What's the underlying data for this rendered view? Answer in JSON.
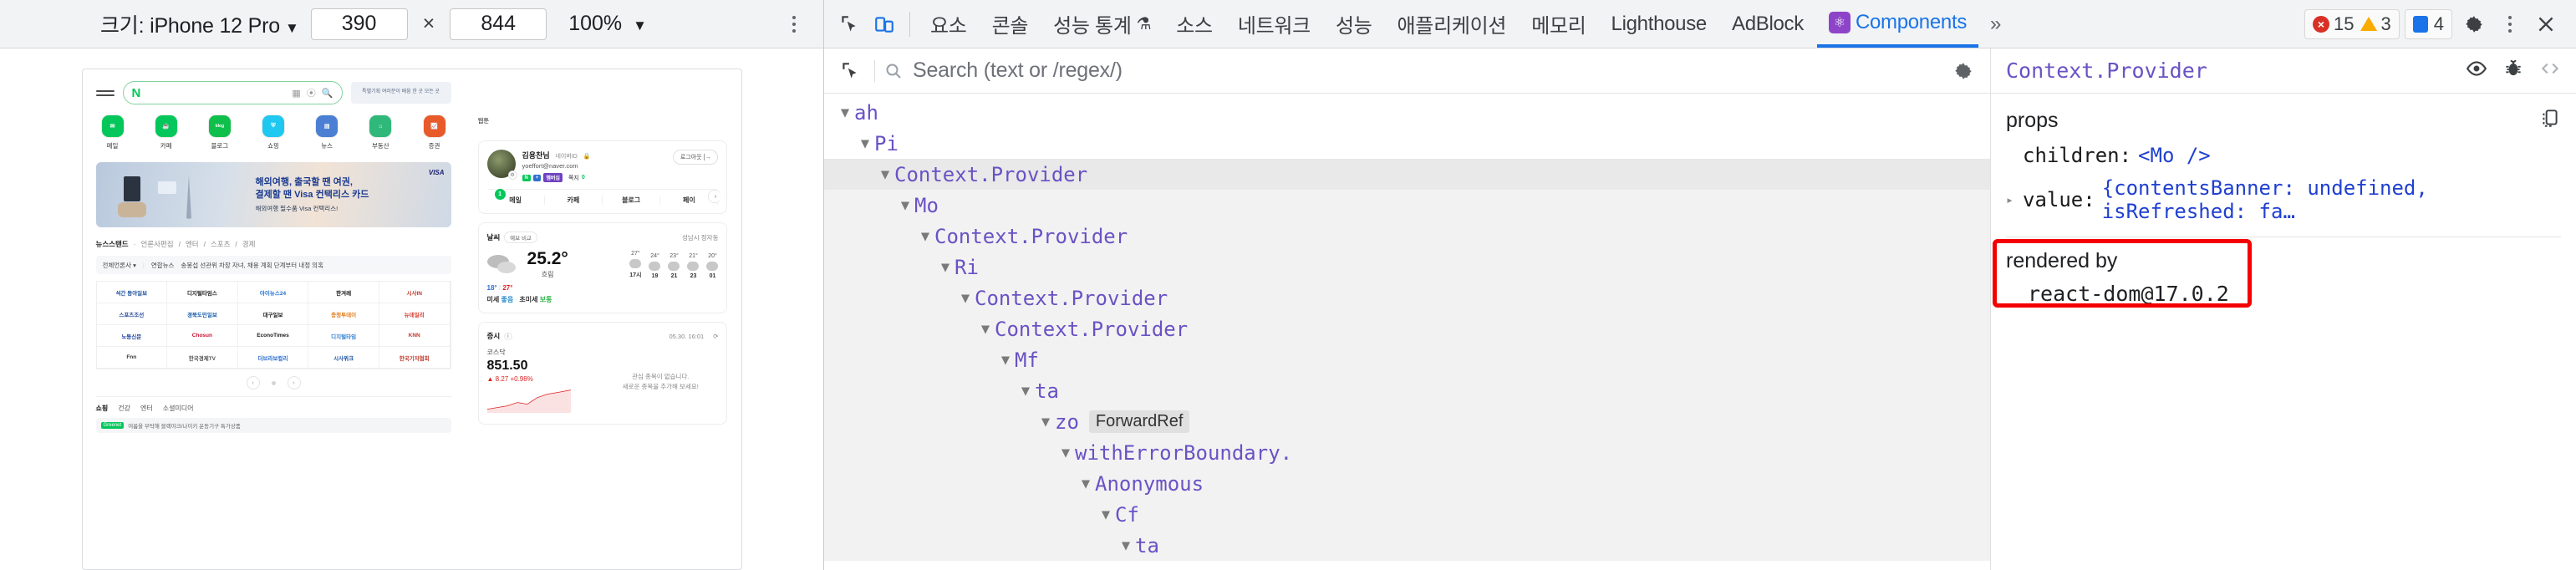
{
  "device_toolbar": {
    "size_label": "크기: iPhone 12 Pro",
    "caret": "▼",
    "width_value": "390",
    "times": "×",
    "height_value": "844",
    "zoom_value": "100%",
    "zoom_caret": "▼",
    "more_icon": "kebab-menu-icon"
  },
  "devtools_tabs": {
    "inspect_icon": "inspect-element-icon",
    "device_icon": "toggle-device-toolbar-icon",
    "items": [
      {
        "label": "요소",
        "active": false
      },
      {
        "label": "콘솔",
        "active": false
      },
      {
        "label": "성능 통계",
        "active": false,
        "icon": "flask-icon"
      },
      {
        "label": "소스",
        "active": false
      },
      {
        "label": "네트워크",
        "active": false
      },
      {
        "label": "성능",
        "active": false
      },
      {
        "label": "애플리케이션",
        "active": false
      },
      {
        "label": "메모리",
        "active": false
      },
      {
        "label": "Lighthouse",
        "active": false
      },
      {
        "label": "AdBlock",
        "active": false
      },
      {
        "label": "Components",
        "active": true,
        "icon": "react-atom-icon"
      }
    ],
    "overflow": "»",
    "error_count": "15",
    "warning_count": "3",
    "message_count": "4",
    "settings_icon": "gear-icon",
    "more_icon": "kebab-menu-icon",
    "close_icon": "close-icon"
  },
  "react_devtools": {
    "select_element_icon": "select-element-icon",
    "search_icon": "search-icon",
    "search_placeholder": "Search (text or /regex/)",
    "search_value": "",
    "settings_icon": "gear-icon",
    "tree": [
      {
        "label": "ah",
        "depth": 0,
        "arrow": "▼",
        "state": "normal"
      },
      {
        "label": "Pi",
        "depth": 1,
        "arrow": "▼",
        "state": "normal"
      },
      {
        "label": "Context.Provider",
        "depth": 2,
        "arrow": "▼",
        "state": "selected"
      },
      {
        "label": "Mo",
        "depth": 3,
        "arrow": "▼",
        "state": "tint"
      },
      {
        "label": "Context.Provider",
        "depth": 4,
        "arrow": "▼",
        "state": "tint"
      },
      {
        "label": "Ri",
        "depth": 5,
        "arrow": "▼",
        "state": "tint"
      },
      {
        "label": "Context.Provider",
        "depth": 6,
        "arrow": "▼",
        "state": "tint"
      },
      {
        "label": "Context.Provider",
        "depth": 7,
        "arrow": "▼",
        "state": "tint"
      },
      {
        "label": "Mf",
        "depth": 8,
        "arrow": "▼",
        "state": "tint"
      },
      {
        "label": "ta",
        "depth": 9,
        "arrow": "▼",
        "state": "tint"
      },
      {
        "label": "zo",
        "depth": 10,
        "arrow": "▼",
        "state": "tint",
        "badge": "ForwardRef"
      },
      {
        "label": "withErrorBoundary.",
        "depth": 11,
        "arrow": "▼",
        "state": "tint"
      },
      {
        "label": "Anonymous",
        "depth": 12,
        "arrow": "▼",
        "state": "tint"
      },
      {
        "label": "Cf",
        "depth": 13,
        "arrow": "▼",
        "state": "tint"
      },
      {
        "label": "ta",
        "depth": 14,
        "arrow": "▼",
        "state": "tint"
      }
    ],
    "inspector": {
      "title": "Context.Provider",
      "eye_icon": "eye-icon",
      "bug_icon": "bug-icon",
      "code_icon": "view-source-icon",
      "props_label": "props",
      "copy_icon": "copy-to-clipboard-icon",
      "props": [
        {
          "key": "children:",
          "value": "<Mo />",
          "expandable": false
        },
        {
          "key": "value:",
          "value": "{contentsBanner: undefined, isRefreshed: fa…",
          "expandable": true,
          "tri": "▸"
        }
      ],
      "rendered_by_label": "rendered by",
      "rendered_by_value": "react-dom@17.0.2",
      "highlight_color": "#f50000"
    }
  },
  "preview": {
    "naver": {
      "logo": "N",
      "search_placeholder": "",
      "ad_text": "특별기획 여러분이 배움 한 곳 모든 곳",
      "shortcuts": [
        {
          "label": "메일",
          "color": "#03c75a",
          "glyph": "✉"
        },
        {
          "label": "카페",
          "color": "#03c75a",
          "glyph": "☕"
        },
        {
          "label": "블로그",
          "color": "#0fbf4b",
          "glyph": "blog"
        },
        {
          "label": "쇼핑",
          "color": "#1ec8f0",
          "glyph": "🛍"
        },
        {
          "label": "뉴스",
          "color": "#4a7fd4",
          "glyph": "📰"
        },
        {
          "label": "부동산",
          "color": "#2fb87a",
          "glyph": "🏠"
        },
        {
          "label": "증권",
          "color": "#e85a2a",
          "glyph": "📈"
        },
        {
          "label": "웹툰",
          "color": "#38c3a4",
          "glyph": "⬚"
        }
      ],
      "banner": {
        "headline_1": "해외여행, 출국할 땐 여권,",
        "headline_2": "결제할 땐 Visa 컨택리스 카드",
        "sub": "해외여행 필수품 Visa 컨택리스!",
        "brand": "VISA"
      },
      "news": {
        "title": "뉴스스탠드",
        "tabs": [
          "언론사편집",
          "엔터",
          "스포츠",
          "경제"
        ],
        "press_filter": "전체언론사 ▾",
        "headline_press": "연합뉴스",
        "headline": "송봉섭 선관위 차장 자녀, 채용 계획 단계부터 내정 의혹",
        "grid": [
          {
            "name": "석간 동아일보",
            "color": "#1b4fa0"
          },
          {
            "name": "디지털타임스",
            "color": "#222222"
          },
          {
            "name": "아이뉴스24",
            "color": "#1f6fd0"
          },
          {
            "name": "한겨레",
            "color": "#111111"
          },
          {
            "name": "시사IN",
            "color": "#c0392b"
          },
          {
            "name": "스포츠조선",
            "color": "#2b4c9b"
          },
          {
            "name": "경북도민일보",
            "color": "#1a5ea8"
          },
          {
            "name": "대구일보",
            "color": "#1b1b1b"
          },
          {
            "name": "충청투데이",
            "color": "#e07b1f"
          },
          {
            "name": "뉴데일리",
            "color": "#d43b2c"
          },
          {
            "name": "노동신문",
            "color": "#1b3fa0"
          },
          {
            "name": "Chosun",
            "color": "#c8102e"
          },
          {
            "name": "EconoTimes",
            "color": "#1b1b1b"
          },
          {
            "name": "디지털타임",
            "color": "#2f7fd0"
          },
          {
            "name": "KNN",
            "color": "#c0392b"
          },
          {
            "name": "Fnn",
            "color": "#333333"
          },
          {
            "name": "한국경제TV",
            "color": "#555555"
          },
          {
            "name": "더브라보컬리",
            "color": "#2f6fd0"
          },
          {
            "name": "시사위크",
            "color": "#1b4fa0"
          },
          {
            "name": "한국기자협회",
            "color": "#c0392b"
          }
        ],
        "page_prev": "‹",
        "page_next": "›"
      },
      "news_tabs2": [
        "쇼핑",
        "건강",
        "엔터",
        "소셜미디어"
      ],
      "bottom_ad": {
        "badge": "Greenet",
        "text": "여름을 부탁해 블랙야크/나이키 운동기구 특가상품"
      },
      "profile": {
        "name": "김용찬님",
        "id_label": "네이버ID",
        "lock_icon": "lock-icon",
        "email": "yoeffort@naver.com",
        "badges": [
          "N",
          "+",
          "멤버십"
        ],
        "note_label": "쪽지",
        "note_count": "0",
        "logout": "로그아웃 [→",
        "menu": [
          "메일",
          "카페",
          "블로그",
          "페이"
        ],
        "menu_badge": "1",
        "more": "›",
        "gear_icon": "gear-icon"
      },
      "weather": {
        "title": "날씨",
        "compare_chip": "예보 비교",
        "location": "성남시 정자동",
        "temp": "25.2°",
        "desc": "흐림",
        "min": "18°",
        "max": "27°",
        "dust_label": "미세",
        "dust_value": "좋음",
        "ultrafine_label": "초미세",
        "ultrafine_value": "보통",
        "hours": [
          {
            "time": "17시",
            "temp": "27°"
          },
          {
            "time": "19",
            "temp": "24°"
          },
          {
            "time": "21",
            "temp": "23°"
          },
          {
            "time": "23",
            "temp": "21°"
          },
          {
            "time": "01",
            "temp": "20°"
          }
        ]
      },
      "stock": {
        "title": "증시",
        "info_icon": "info-icon",
        "timestamp": "05.30. 16:01",
        "refresh_icon": "refresh-icon",
        "index_name": "코스닥",
        "index_value": "851.50",
        "index_change": "▲ 8.27  +0.98%",
        "empty_line1": "관심 종목이 없습니다.",
        "empty_line2": "새로운 종목을 추가해 보세요!"
      }
    }
  }
}
